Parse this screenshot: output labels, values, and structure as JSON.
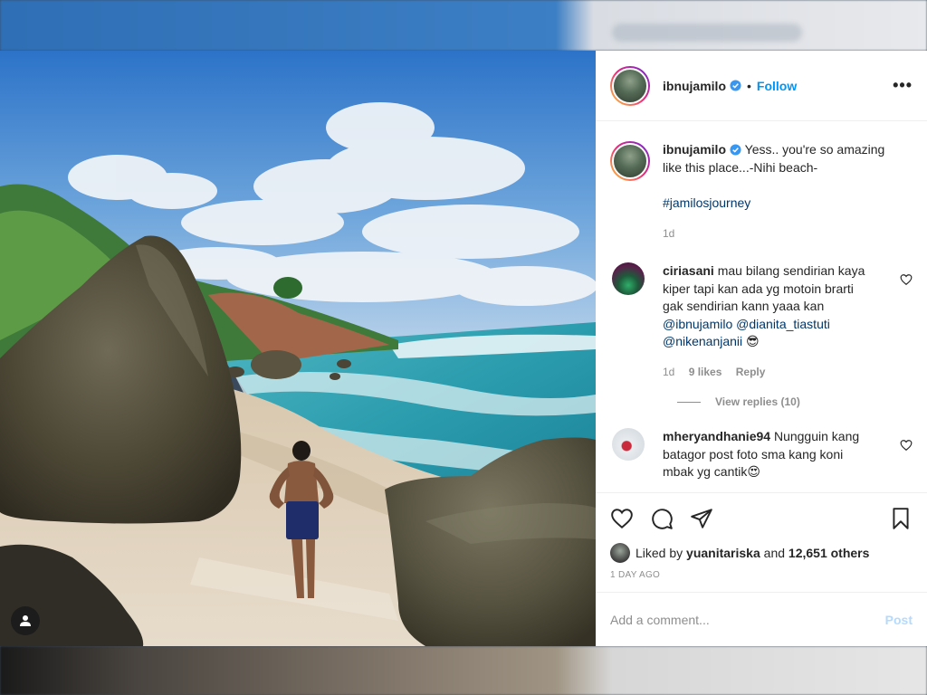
{
  "post": {
    "username": "ibnujamilo",
    "follow_label": "Follow",
    "separator": "•",
    "more_label": "•••"
  },
  "caption": {
    "username": "ibnujamilo",
    "text": "Yess.. you're so amazing like this place...-Nihi beach-",
    "hashtag": "#jamilosjourney",
    "time": "1d"
  },
  "comments": [
    {
      "username": "ciriasani",
      "text": "mau bilang sendirian kaya kiper tapi kan ada yg motoin brarti gak sendirian kann yaaa kan",
      "mention1": "@ibnujamilo",
      "mention2": "@dianita_tiastuti",
      "mention3": "@nikenanjanii",
      "emoji": "😎",
      "time": "1d",
      "likes": "9 likes",
      "reply_label": "Reply",
      "view_replies": "View replies (10)"
    },
    {
      "username": "mheryandhanie94",
      "text": "Nungguin kang batagor post foto sma kang koni mbak yg cantik",
      "emoji": "😍"
    }
  ],
  "likes": {
    "prefix": "Liked by",
    "user": "yuanitariska",
    "connector": "and",
    "count": "12,651 others"
  },
  "post_date": "1 DAY AGO",
  "add_comment": {
    "placeholder": "Add a comment...",
    "post_label": "Post"
  },
  "colors": {
    "accent": "#0095f6",
    "post_disabled": "#b3dbff",
    "hashtag": "#00376b"
  },
  "icons": [
    "user-tag-icon",
    "verified-badge-icon",
    "more-options-icon",
    "heart-icon",
    "comment-icon",
    "share-icon",
    "save-icon"
  ]
}
